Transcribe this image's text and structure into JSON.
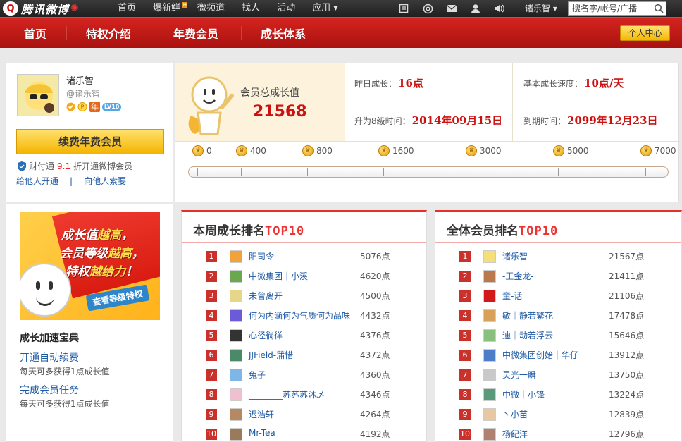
{
  "topbar": {
    "brand": "腾讯微博",
    "logo_glyph": "Q",
    "nav": [
      "首页",
      "爆新鲜",
      "微频道",
      "找人",
      "活动",
      "应用 ▾"
    ],
    "nav_badge": "H",
    "icons": [
      "document-icon",
      "mention-icon",
      "mail-icon",
      "user-icon",
      "sound-icon"
    ],
    "username": "诸乐智 ▾",
    "search_placeholder": "搜名字/帐号/广播"
  },
  "rednav": {
    "items": [
      "首页",
      "特权介绍",
      "年费会员",
      "成长体系"
    ],
    "personal_center": "个人中心"
  },
  "profile": {
    "name": "诸乐智",
    "handle": "@诸乐智",
    "year_badge": "年",
    "level_badge": "LV10",
    "renew_button": "续费年费会员",
    "pay_text_prefix": "财付通",
    "pay_discount": "9.1",
    "pay_text_suffix": "折开通微博会员",
    "link_gift": "给他人开通",
    "link_sep": "|",
    "link_ask": "向他人索要"
  },
  "growth": {
    "total_label": "会员总成长值",
    "total_value": "21568",
    "yesterday_label": "昨日成长：",
    "yesterday_value": "16点",
    "speed_label": "基本成长速度：",
    "speed_value": "10点/天",
    "upgrade_label": "升为8级时间：",
    "upgrade_value": "2014年09月15日",
    "expire_label": "到期时间：",
    "expire_value": "2099年12月23日",
    "milestones": [
      "0",
      "400",
      "800",
      "1600",
      "3000",
      "5000",
      "7000"
    ]
  },
  "promo": {
    "line1_a": "成长值",
    "line1_b": "越高",
    "line1_c": "，",
    "line2_a": "会员等级",
    "line2_b": "越高",
    "line2_c": "，",
    "line3_a": "特权",
    "line3_b": "越给力",
    "line3_c": "！",
    "button": "查看等级特权"
  },
  "boost": {
    "title": "成长加速宝典",
    "item1": "开通自动续费",
    "item1_sub": "每天可多获得1点成长值",
    "item2": "完成会员任务",
    "item2_sub": "每天可多获得1点成长值"
  },
  "weekly": {
    "title": "本周成长排名",
    "title_top": "TOP10",
    "rows": [
      {
        "rank": "1",
        "name": "阳司令",
        "points": "5076点"
      },
      {
        "rank": "2",
        "name": "中微集团｜小溪",
        "points": "4620点"
      },
      {
        "rank": "3",
        "name": "未曾离开",
        "points": "4500点"
      },
      {
        "rank": "4",
        "name": "何为内涵何为气质何为品味",
        "points": "4432点"
      },
      {
        "rank": "5",
        "name": "心径徜徉",
        "points": "4376点"
      },
      {
        "rank": "6",
        "name": "JJField-蒲惜",
        "points": "4372点"
      },
      {
        "rank": "7",
        "name": "兔子",
        "points": "4360点"
      },
      {
        "rank": "8",
        "name": "________苏苏苏沐乄",
        "points": "4346点"
      },
      {
        "rank": "9",
        "name": "迟浩轩",
        "points": "4264点"
      },
      {
        "rank": "10",
        "name": "Mr-Tea",
        "points": "4192点"
      }
    ]
  },
  "all": {
    "title": "全体会员排名",
    "title_top": "TOP10",
    "rows": [
      {
        "rank": "1",
        "name": "诸乐智",
        "points": "21567点"
      },
      {
        "rank": "2",
        "name": "-王金龙-",
        "points": "21411点"
      },
      {
        "rank": "3",
        "name": "童-话",
        "points": "21106点"
      },
      {
        "rank": "4",
        "name": "敏｜静若繁花",
        "points": "17478点"
      },
      {
        "rank": "5",
        "name": "迪｜动若浮云",
        "points": "15646点"
      },
      {
        "rank": "6",
        "name": "中微集团创始｜华仔",
        "points": "13912点"
      },
      {
        "rank": "7",
        "name": "灵光一瞬",
        "points": "13750点"
      },
      {
        "rank": "8",
        "name": "中微｜小锋",
        "points": "13224点"
      },
      {
        "rank": "9",
        "name": "丶小苗",
        "points": "12839点"
      },
      {
        "rank": "10",
        "name": "杨纪洋",
        "points": "12796点"
      }
    ]
  }
}
